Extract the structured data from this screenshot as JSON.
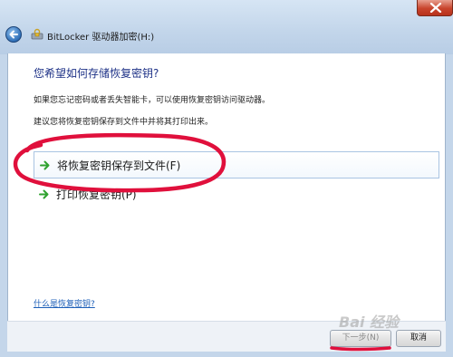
{
  "window": {
    "title": "BitLocker 驱动器加密(H:)"
  },
  "main": {
    "heading": "您希望如何存储恢复密钥?",
    "description_1": "如果您忘记密码或者丢失智能卡，可以使用恢复密钥访问驱动器。",
    "description_2": "建议您将恢复密钥保存到文件中并将其打印出来。",
    "options": [
      {
        "label": "将恢复密钥保存到文件(F)",
        "icon": "green-arrow-icon"
      },
      {
        "label": "打印恢复密钥(P)",
        "icon": "green-arrow-icon"
      }
    ],
    "help_link": "什么是恢复密钥?"
  },
  "footer": {
    "next_label": "下一步(N)",
    "cancel_label": "取消"
  },
  "watermark": {
    "text": "Bai 经验"
  },
  "colors": {
    "heading": "#1e3287",
    "link": "#1d5fb8",
    "annotation": "#e0103c",
    "option_arrow": "#2fa22f"
  }
}
